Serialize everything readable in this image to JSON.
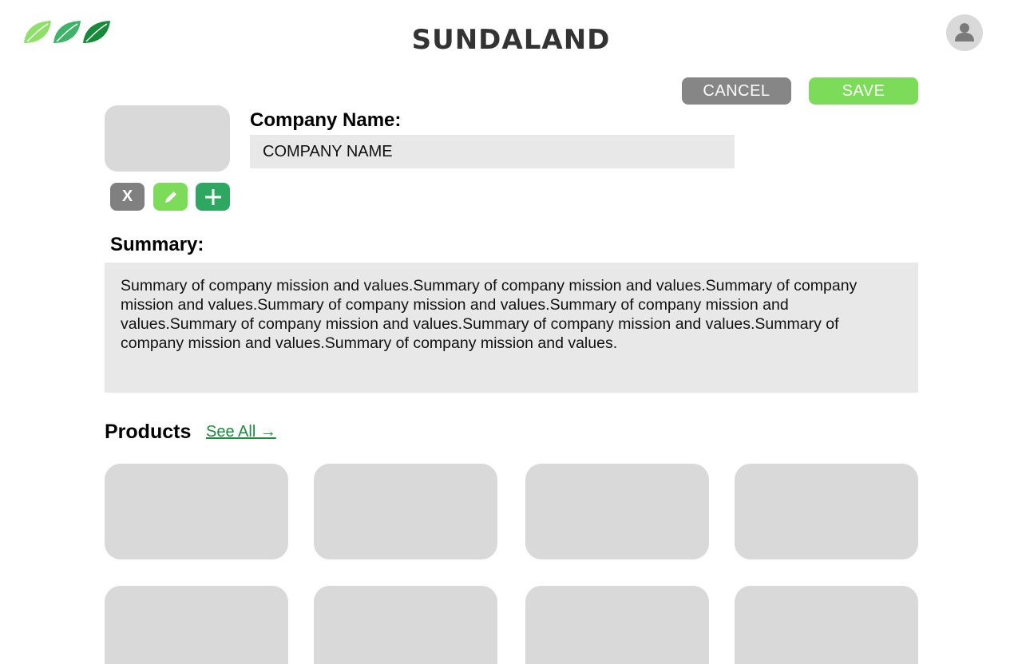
{
  "header": {
    "brand": "SUNDALAND",
    "logo_icon": "leaves-logo-icon",
    "avatar_icon": "user-icon"
  },
  "actions": {
    "cancel_label": "CANCEL",
    "save_label": "SAVE"
  },
  "image_controls": {
    "remove_label": "X",
    "edit_icon": "pencil-icon",
    "add_icon": "plus-icon"
  },
  "company": {
    "label": "Company Name:",
    "value": "COMPANY NAME"
  },
  "summary": {
    "label": "Summary:",
    "text": "Summary of company mission and values.Summary of company mission and values.Summary of company mission and values.Summary of company mission and values.Summary of company mission and values.Summary of company mission and values.Summary of company mission and values.Summary of company mission and values.Summary of company mission and values."
  },
  "products": {
    "title": "Products",
    "see_all": "See All →",
    "card_count_visible": 8
  },
  "colors": {
    "accent_green": "#7ddb5a",
    "dark_green": "#2ea760",
    "gray_button": "#868686",
    "placeholder": "#d9d9d9",
    "input_bg": "#e8e8e8",
    "link": "#1f8a3d"
  }
}
